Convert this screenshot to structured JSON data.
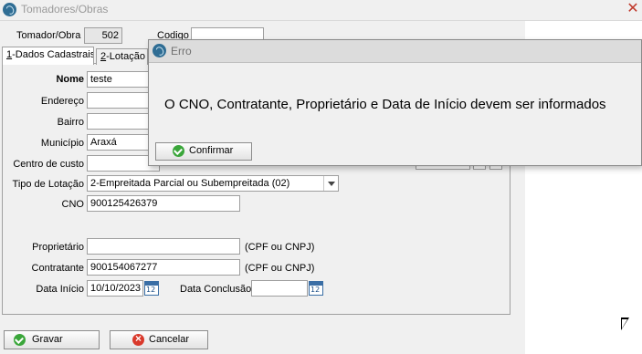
{
  "window": {
    "title": "Tomadores/Obras",
    "close_glyph": "✕"
  },
  "header": {
    "tomador_obra_label": "Tomador/Obra",
    "tomador_obra_value": "502",
    "codigo_label": "Codigo",
    "codigo_value": ""
  },
  "tabs": [
    {
      "label_prefix": "1",
      "label_rest": "-Dados Cadastrais",
      "active": true
    },
    {
      "label_prefix": "2",
      "label_rest": "-Lotação T",
      "active": false
    }
  ],
  "form": {
    "nome_label": "Nome",
    "nome_value": "teste",
    "endereco_label": "Endereço",
    "endereco_value": "",
    "bairro_label": "Bairro",
    "bairro_value": "",
    "municipio_label": "Município",
    "municipio_value": "Araxá",
    "centro_custo_label": "Centro de custo",
    "centro_custo_value": "",
    "tipo_lotacao_label": "Tipo de Lotação",
    "tipo_lotacao_value": "2-Empreitada Parcial ou Subempreitada (02)",
    "cno_label": "CNO",
    "cno_value": "900125426379",
    "proprietario_label": "Proprietário",
    "proprietario_value": "",
    "proprietario_hint": "(CPF ou CNPJ)",
    "contratante_label": "Contratante",
    "contratante_value": "900154067277",
    "contratante_hint": "(CPF ou CNPJ)",
    "data_inicio_label": "Data Início",
    "data_inicio_value": "10/10/2023",
    "data_conclusao_label": "Data Conclusão",
    "data_conclusao_value": "",
    "calendar_icon_text": "12"
  },
  "buttons": {
    "gravar": "Gravar",
    "cancelar": "Cancelar"
  },
  "dialog": {
    "title": "Erro",
    "message": "O CNO, Contratante, Proprietário e Data de Início devem ser informados",
    "confirm": "Confirmar"
  },
  "icons": {
    "app_icon": "app-logo-icon",
    "close_icon": "close-icon",
    "ok_icon": "check-circle-icon",
    "cancel_icon": "cancel-circle-icon",
    "calendar_icon": "calendar-icon",
    "dropdown_icon": "chevron-down-icon"
  },
  "colors": {
    "ok_green": "#3aa63a",
    "cancel_red": "#d9392b",
    "app_blue": "#2f6d94"
  }
}
